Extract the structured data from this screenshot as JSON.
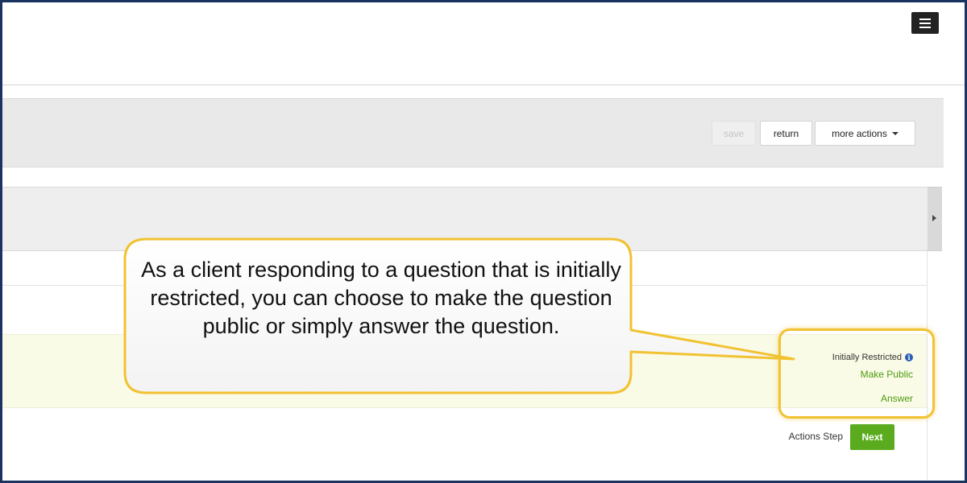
{
  "toolbar": {
    "save_label": "save",
    "return_label": "return",
    "more_actions_label": "more actions"
  },
  "question_row": {
    "status_text": "Initially Restricted",
    "info_icon_glyph": "i",
    "make_public_label": "Make Public",
    "answer_label": "Answer"
  },
  "footer": {
    "actions_step_label": "Actions Step",
    "next_label": "Next"
  },
  "callout": {
    "text": "As a client responding to a question that is initially restricted, you can choose to make the question public or simply answer the question."
  },
  "colors": {
    "accent_green": "#5aac1e",
    "link_green": "#4d9a13",
    "callout_border": "#f1c232",
    "frame_border": "#1b3360",
    "highlight_row": "#fafbe6"
  },
  "icons": {
    "menu": "hamburger-menu-icon",
    "info": "info-icon",
    "dropdown": "caret-down-icon",
    "panel_toggle": "caret-right-icon"
  }
}
